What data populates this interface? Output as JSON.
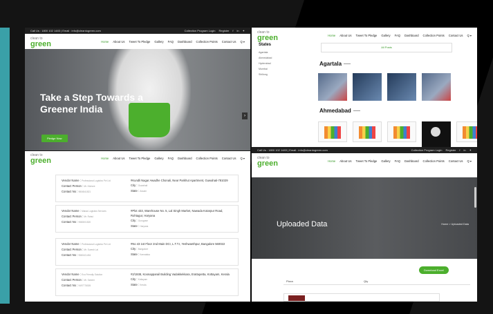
{
  "topbar": {
    "call": "Call Us : 1800 102 1483",
    "email": "Email : info@cleantogreen.com",
    "links": [
      "Collection Program Login",
      "Register"
    ]
  },
  "logo": {
    "line1": "clean to",
    "line2": "green"
  },
  "menu": [
    "Home",
    "About Us",
    "Tweet To Pledge",
    "Gallery",
    "FAQ",
    "Dashboard",
    "Collection Points",
    "Contact Us",
    "Q ▾"
  ],
  "hero": {
    "title": "Take a Step Towards a Greener India",
    "cta": "Pledge Now",
    "next": "›"
  },
  "gallery": {
    "sidebar_title": "States",
    "states": [
      "Agartala",
      "Ahmedabad",
      "Hyderabad",
      "Mumbai",
      "Shillong"
    ],
    "filter": "All Posts",
    "cities": [
      "Agartala",
      "Ahmedabad"
    ]
  },
  "vendors": [
    {
      "name_label": "Vendor Name :",
      "name": "Professional Logistics Pvt Ltd",
      "person_label": "Contact Person :",
      "person": "Mr. Kishore",
      "no_label": "Contact No :",
      "no": "9804541521",
      "addr": "#Kundli Nagar Awadhe Chonali, Near Parkhut Apartment, Guwahati-781029",
      "city_label": "City :",
      "city": "Guwahati",
      "state_label": "State :",
      "state": "Assam"
    },
    {
      "name_label": "Vendor Name :",
      "name": "Malwa Logistics Services",
      "person_label": "Contact Person :",
      "person": "Mr. Rahul",
      "no_label": "Contact No :",
      "no": "9580001520",
      "addr": "#Plot 433, Warehouse No. 5, Lal Singh Market, Nawada Kotarpur Road, Rohtagur, Haryana",
      "city_label": "City :",
      "city": "Gurugram",
      "state_label": "State :",
      "state": "Haryana"
    },
    {
      "name_label": "Vendor Name :",
      "name": "Professional Logistics Pvt Ltd",
      "person_label": "Contact Person :",
      "person": "Mr. Suresh Lal",
      "no_label": "Contact No :",
      "no": "9580101494",
      "addr": "#No 43 1st Floor 2nd Main DCI, L.T.T.I, Yeshwanthpur, Bangalore 560022",
      "city_label": "City :",
      "city": "Bangalore",
      "state_label": "State :",
      "state": "Karnataka"
    },
    {
      "name_label": "Vendor Name :",
      "name": "Eco Friendly Solution",
      "person_label": "Contact Person :",
      "person": "Mr. Saheer",
      "no_label": "Contact No :",
      "no": "9497778305",
      "addr": "#2/1938, Koonapparail Building Vadakkekkara, Erattupetta, Kottayam, Kerala",
      "city_label": "City :",
      "city": "Kottayam",
      "state_label": "State :",
      "state": "Kerala"
    }
  ],
  "uploaded": {
    "title": "Uploaded Data",
    "crumb": "Home > Uploaded Data",
    "download": "Download Excel",
    "col1": "Pizza",
    "col2": "Qty"
  }
}
